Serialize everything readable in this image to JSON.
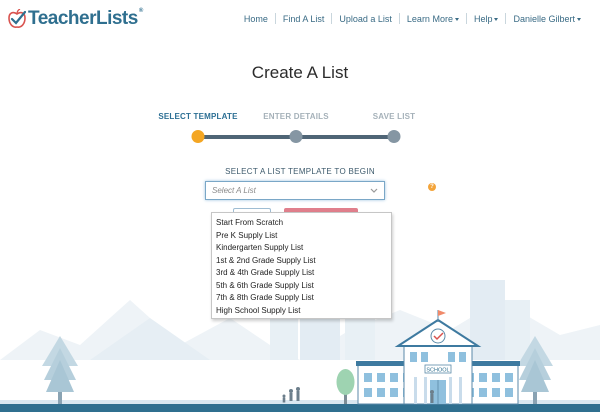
{
  "brand": {
    "name": "TeacherLists",
    "tm": "®"
  },
  "nav": {
    "home": "Home",
    "find": "Find A List",
    "upload": "Upload a List",
    "learn": "Learn More",
    "help": "Help",
    "user": "Danielle Gilbert"
  },
  "page": {
    "title": "Create A List"
  },
  "steps": [
    {
      "label": "SELECT TEMPLATE",
      "state": "active"
    },
    {
      "label": "ENTER DETAILS",
      "state": "inactive"
    },
    {
      "label": "SAVE LIST",
      "state": "inactive"
    }
  ],
  "template_select": {
    "label": "SELECT A LIST TEMPLATE TO BEGIN",
    "placeholder": "Select A List",
    "help": "?",
    "options": [
      "Start From Scratch",
      "Pre K Supply List",
      "Kindergarten Supply List",
      "1st & 2nd Grade Supply List",
      "3rd & 4th Grade Supply List",
      "5th & 6th Grade Supply List",
      "7th & 8th Grade Supply List",
      "High School Supply List"
    ]
  },
  "illustration": {
    "school_sign": "SCHOOL"
  },
  "colors": {
    "brand": "#2f6f8f",
    "active_step": "#f4a623",
    "inactive_step": "#8596a3",
    "danger_button": "#e07f8c"
  }
}
